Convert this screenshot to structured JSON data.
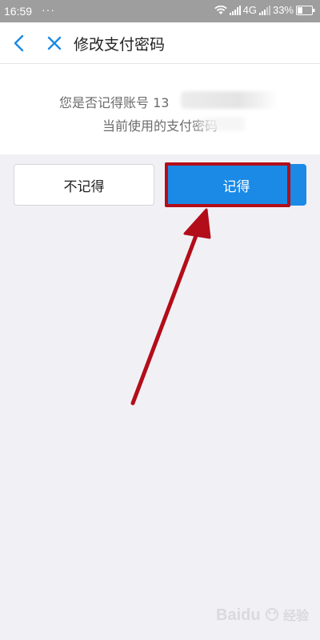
{
  "status_bar": {
    "time": "16:59",
    "dots": "···",
    "network": "4G",
    "battery": "33%"
  },
  "nav": {
    "title": "修改支付密码",
    "back_icon": "chevron-left-icon",
    "close_icon": "close-icon"
  },
  "prompt": {
    "line1": "您是否记得账号 13",
    "line2": "当前使用的支付密码"
  },
  "buttons": {
    "no_label": "不记得",
    "yes_label": "记得"
  },
  "watermark": {
    "brand": "Baidu",
    "suffix": "经验"
  },
  "colors": {
    "accent": "#1a8ae6",
    "annotation": "#b30d1a",
    "nav_icon": "#1a8ae6"
  }
}
